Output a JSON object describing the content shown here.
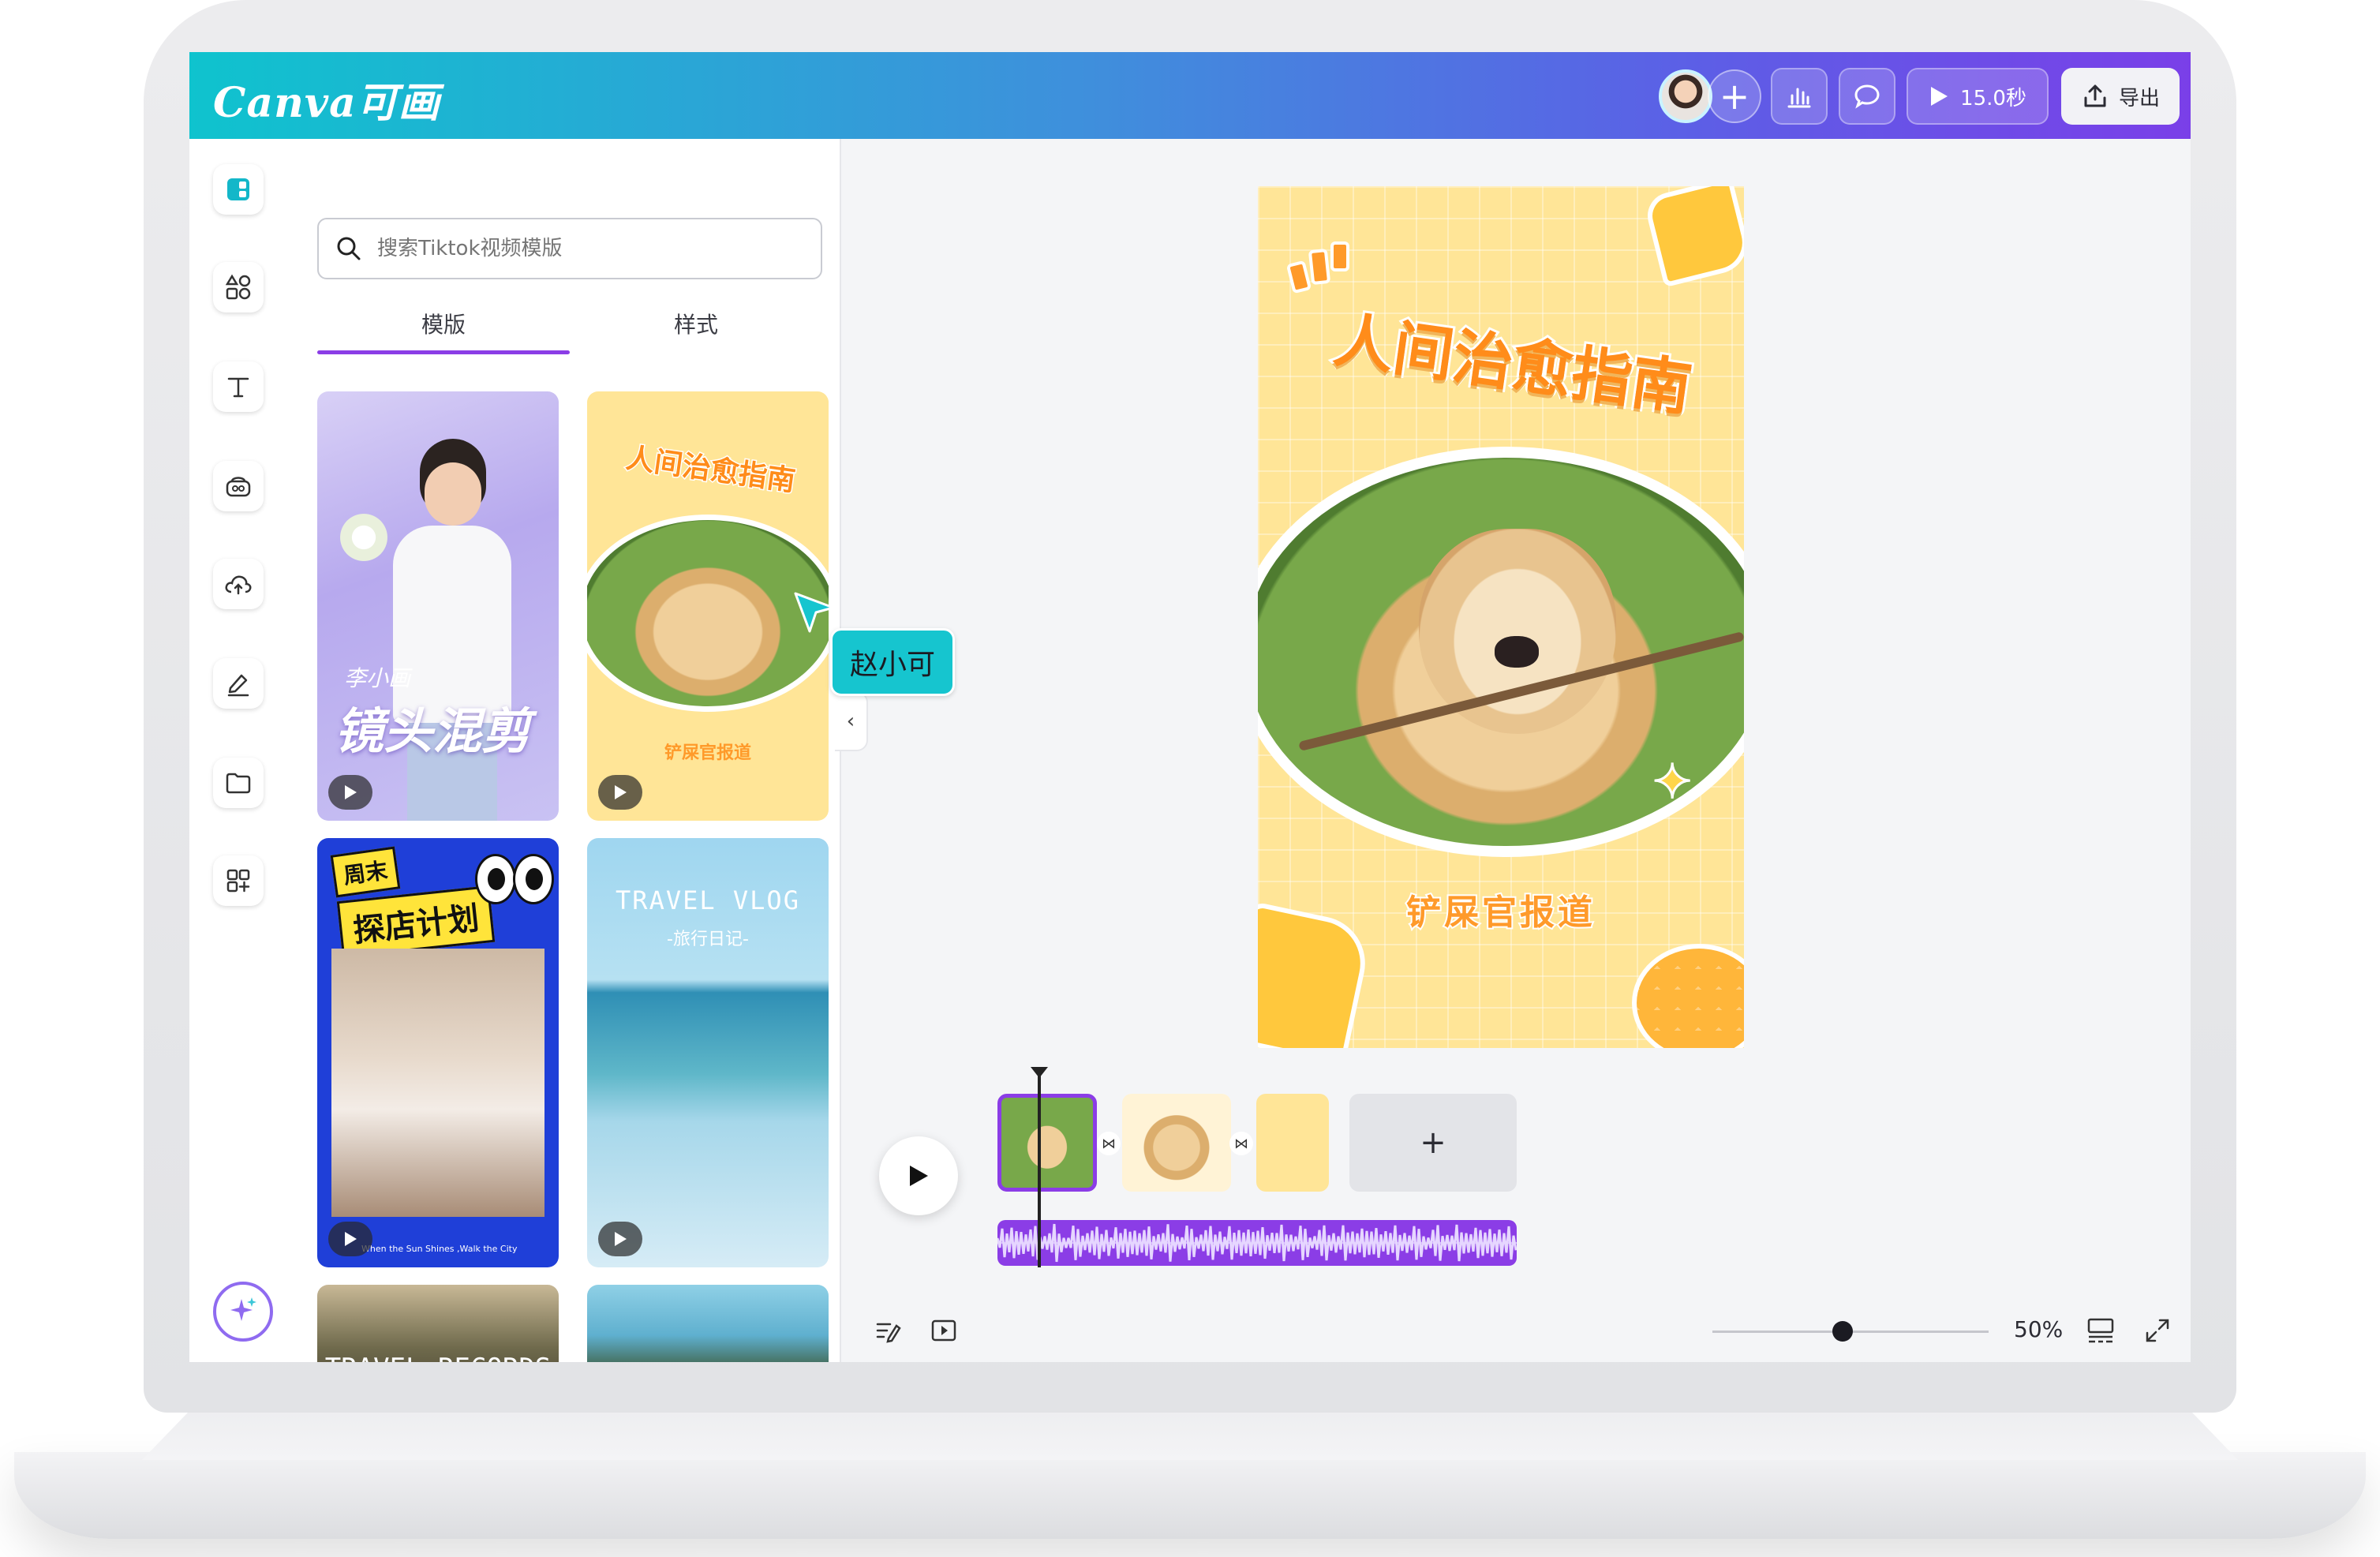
{
  "app": {
    "logo_text": "Canva可画"
  },
  "header": {
    "duration_label": "15.0秒",
    "export_label": "导出"
  },
  "panel": {
    "search_placeholder": "搜索Tiktok视频模版",
    "tabs": [
      {
        "label": "模版",
        "active": true
      },
      {
        "label": "样式",
        "active": false
      }
    ],
    "templates": [
      {
        "title": "镜头混剪",
        "subtitle": "李小画"
      },
      {
        "title": "人间治愈指南",
        "subtitle": "铲屎官报道"
      },
      {
        "title": "探店计划",
        "subtitle": "周末",
        "caption": "When the Sun Shines ,Walk the City"
      },
      {
        "title": "TRAVEL VLOG",
        "subtitle": "-旅行日记-"
      },
      {
        "title": "TRAVEL RECORDS",
        "subtitle": ""
      },
      {
        "title": "",
        "subtitle": ""
      }
    ]
  },
  "collaborator": {
    "name": "赵小可",
    "color": "#16c5cf"
  },
  "design": {
    "title": "人间治愈指南",
    "subtitle": "铲屎官报道"
  },
  "timeline": {
    "add_label": "+"
  },
  "bottom_bar": {
    "zoom_label": "50%",
    "zoom_value": 0.5
  },
  "colors": {
    "accent": "#8b3de6",
    "header_start": "#0fc3ce",
    "header_end": "#7a3fe8",
    "design_bg": "#ffe597"
  }
}
